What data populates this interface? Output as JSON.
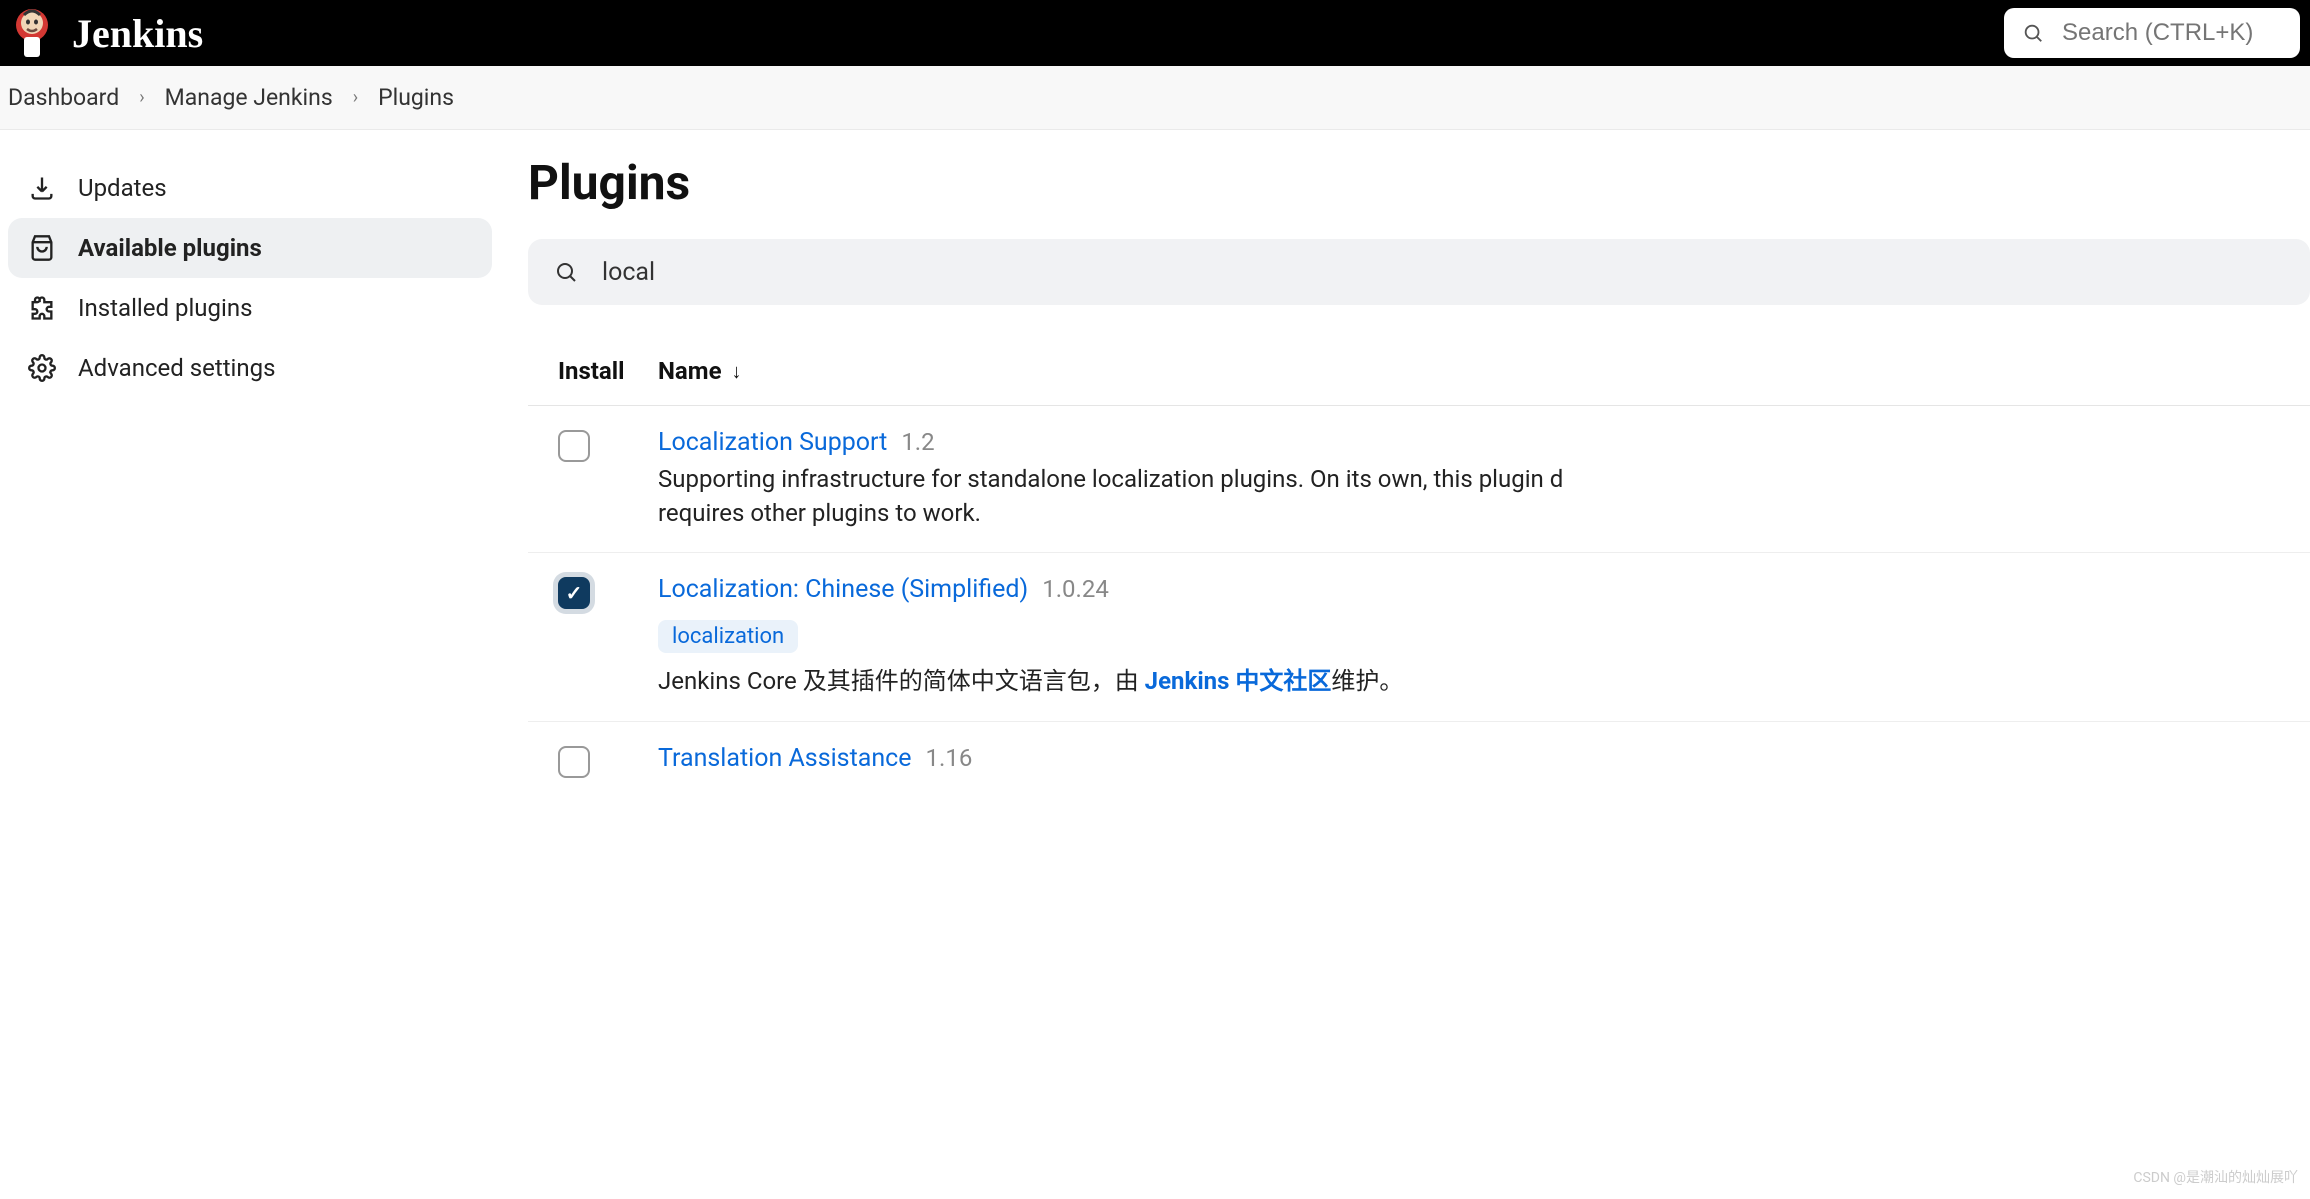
{
  "header": {
    "brand": "Jenkins",
    "search_placeholder": "Search (CTRL+K)"
  },
  "breadcrumb": {
    "items": [
      "Dashboard",
      "Manage Jenkins",
      "Plugins"
    ]
  },
  "sidebar": {
    "items": [
      {
        "label": "Updates"
      },
      {
        "label": "Available plugins"
      },
      {
        "label": "Installed plugins"
      },
      {
        "label": "Advanced settings"
      }
    ]
  },
  "page": {
    "title": "Plugins",
    "filter_value": "local"
  },
  "table": {
    "col_install": "Install",
    "col_name": "Name",
    "sort_indicator": "↓"
  },
  "plugins": [
    {
      "name": "Localization Support",
      "version": "1.2",
      "checked": false,
      "tag": "",
      "desc_prefix": "Supporting infrastructure for standalone localization plugins. On its own, this plugin d",
      "desc_line2": "requires other plugins to work.",
      "desc_link": "",
      "desc_suffix": ""
    },
    {
      "name": "Localization: Chinese (Simplified)",
      "version": "1.0.24",
      "checked": true,
      "tag": "localization",
      "desc_prefix": "Jenkins Core 及其插件的简体中文语言包，由 ",
      "desc_line2": "",
      "desc_link": "Jenkins 中文社区",
      "desc_suffix": "维护。"
    },
    {
      "name": "Translation Assistance",
      "version": "1.16",
      "checked": false,
      "tag": "",
      "desc_prefix": "",
      "desc_line2": "",
      "desc_link": "",
      "desc_suffix": ""
    }
  ],
  "watermark": "CSDN @是潮汕的灿灿展吖"
}
